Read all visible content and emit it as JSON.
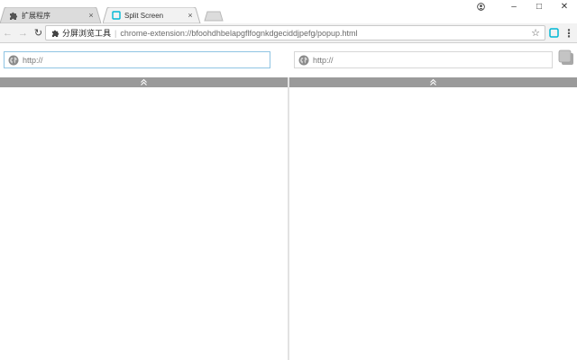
{
  "tabs": [
    {
      "title": "扩展程序",
      "close": "×",
      "icon": "puzzle-icon",
      "active": false
    },
    {
      "title": "Split Screen",
      "close": "×",
      "icon": "split-screen-icon",
      "active": true
    }
  ],
  "window": {
    "minimize": "–",
    "maximize": "□",
    "close": "✕",
    "profile_icon": "account-icon"
  },
  "toolbar": {
    "back": "←",
    "forward": "→",
    "reload": "↻",
    "origin_label": "分屏浏览工具",
    "separator": "|",
    "url": "chrome-extension://bfoohdhbelapgflfognkdgeciddjpefg/popup.html",
    "star": "☆",
    "menu": "⋮"
  },
  "split": {
    "left_url_value": "http://",
    "right_url_value": "http://",
    "collapse_glyph": "⌃⌃"
  },
  "colors": {
    "accent": "#00b8d4",
    "collapse_bar": "#9a9a9a",
    "focus_border": "#8fc4e3"
  }
}
